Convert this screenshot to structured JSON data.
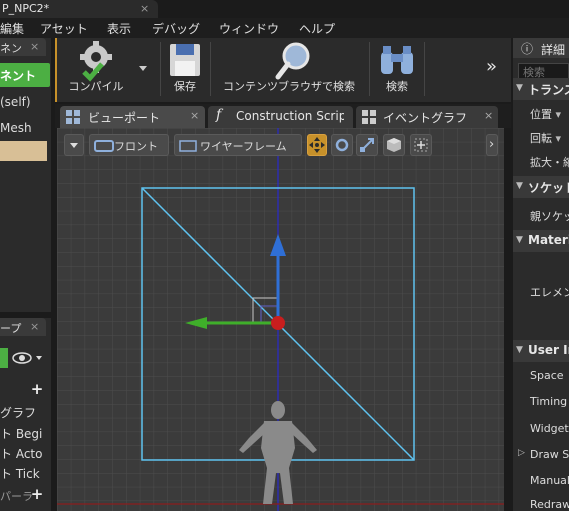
{
  "window": {
    "title": "P_NPC2*",
    "close": "×"
  },
  "menu": [
    "編集",
    "アセット",
    "表示",
    "デバッグ",
    "ウィンドウ",
    "ヘルプ"
  ],
  "left_panel": {
    "tab": "ネン",
    "tab_close": "×",
    "add_button": "ネント",
    "self_item": "(self)",
    "mesh_item": "Mesh"
  },
  "left_panel_lower": {
    "tab": "ープ",
    "tab_close": "×",
    "plus1": "+",
    "items": [
      "グラフ",
      "ト Begi",
      "ト Acto",
      "ト Tick"
    ],
    "vars_label": "パーラ",
    "plus2": "+"
  },
  "toolbar": {
    "compile": "コンパイル",
    "save": "保存",
    "browse": "コンテンツブラウザで検索",
    "find": "検索",
    "more": "»"
  },
  "editor_tabs": [
    {
      "label": "ビューポート",
      "close": "×"
    },
    {
      "label": "Construction Scrip",
      "close": ""
    },
    {
      "label": "イベントグラフ",
      "close": "×"
    }
  ],
  "viewport": {
    "view_mode": "フロント",
    "render_mode": "ワイヤーフレーム",
    "expand": "›"
  },
  "details": {
    "tab": "詳細",
    "tab_icon": "ⓘ",
    "search_placeholder": "検索",
    "transform_header": "トランス",
    "location": "位置",
    "rotation": "回転",
    "scale": "拡大・縮",
    "sockets_header": "ソケット",
    "parent_socket": "親ソケッ",
    "materials_header": "Materia",
    "elements": "エレメン",
    "ui_header": "User In",
    "space": "Space",
    "timing": "Timing",
    "widget": "Widget C",
    "draw": "Draw Si",
    "manual": "Manuall",
    "redraw": "Redraw"
  },
  "colors": {
    "accent_orange": "#c7912a",
    "green_button": "#4caf43",
    "selection_tan": "#d8bf96",
    "wire_blue": "#5fc3f0",
    "axis_blue": "#2f6fd6",
    "axis_green": "#3fae2a",
    "pivot_red": "#c81e1e"
  }
}
